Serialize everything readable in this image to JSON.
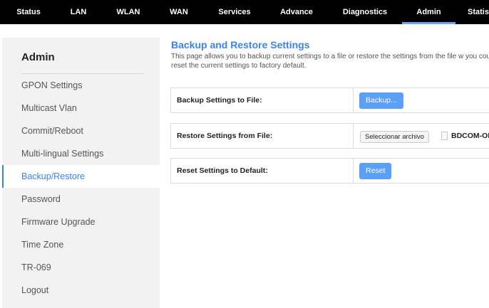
{
  "nav": {
    "tabs": [
      {
        "label": "Status"
      },
      {
        "label": "LAN"
      },
      {
        "label": "WLAN"
      },
      {
        "label": "WAN"
      },
      {
        "label": "Services"
      },
      {
        "label": "Advance"
      },
      {
        "label": "Diagnostics"
      },
      {
        "label": "Admin"
      },
      {
        "label": "Statis"
      }
    ],
    "active": "Admin",
    "accent": "#6ea3ff"
  },
  "sidebar": {
    "title": "Admin",
    "items": [
      {
        "label": "GPON Settings"
      },
      {
        "label": "Multicast Vlan"
      },
      {
        "label": "Commit/Reboot"
      },
      {
        "label": "Multi-lingual Settings"
      },
      {
        "label": "Backup/Restore"
      },
      {
        "label": "Password"
      },
      {
        "label": "Firmware Upgrade"
      },
      {
        "label": "Time Zone"
      },
      {
        "label": "TR-069"
      },
      {
        "label": "Logout"
      }
    ],
    "active": "Backup/Restore"
  },
  "main": {
    "title": "Backup and Restore Settings",
    "description": "This page allows you to backup current settings to a file or restore the settings from the file w you could reset the current settings to factory default.",
    "rows": {
      "backup": {
        "label": "Backup Settings to File:",
        "button": "Backup..."
      },
      "restore": {
        "label": "Restore Settings from File:",
        "file_button": "Seleccionar archivo",
        "file_name": "BDCOM-OI"
      },
      "reset": {
        "label": "Reset Settings to Default:",
        "button": "Reset"
      }
    },
    "accent": "#3b82f6",
    "button_color": "#5aa0f8"
  }
}
